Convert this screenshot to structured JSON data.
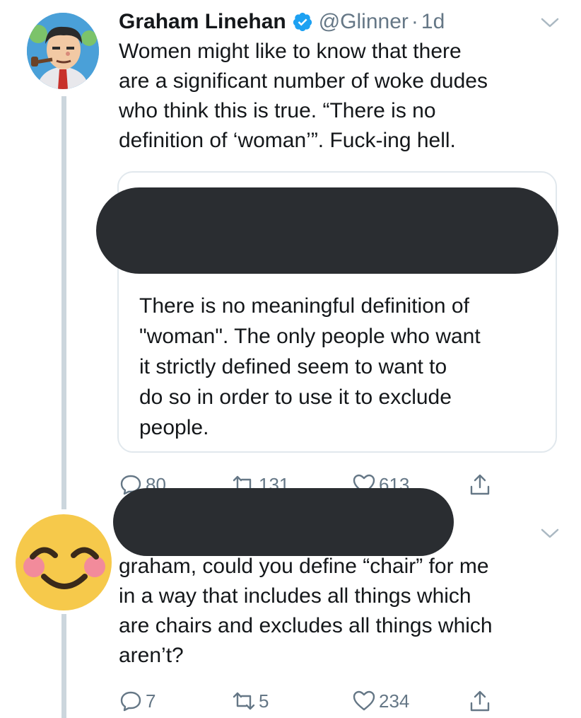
{
  "tweet1": {
    "display_name": "Graham Linehan",
    "handle": "@Glinner",
    "separator": "·",
    "time": "1d",
    "text": "Women might like to know that there\nare a significant number of woke dudes\nwho think this is true. “There is no\ndefinition of ‘woman’”. Fuck-ing hell.",
    "quoted_tweet": {
      "text": "There is no meaningful definition of\n\"woman\". The only people who want\nit strictly defined seem to want to\ndo so in order to use it to exclude\npeople."
    },
    "actions": {
      "replies": "80",
      "retweets": "131",
      "likes": "613"
    }
  },
  "tweet2": {
    "text": "graham, could you define “chair” for me\nin a way that includes all things which\nare chairs and excludes all things which\naren’t?",
    "actions": {
      "replies": "7",
      "retweets": "5",
      "likes": "234"
    }
  },
  "icons": {
    "verified": "verified-badge-icon",
    "caret": "chevron-down-icon",
    "reply": "reply-icon",
    "retweet": "retweet-icon",
    "like": "heart-icon",
    "share": "share-icon",
    "emoji": "blushing-smile-emoji"
  },
  "colors": {
    "verified_blue": "#1da1f2",
    "muted_text": "#657786",
    "thread_line": "#ccd6dd",
    "card_border": "#e1e8ed",
    "redaction": "#2a2d31",
    "emoji_face": "#f6c94b",
    "emoji_cheek": "#f28b9b"
  }
}
